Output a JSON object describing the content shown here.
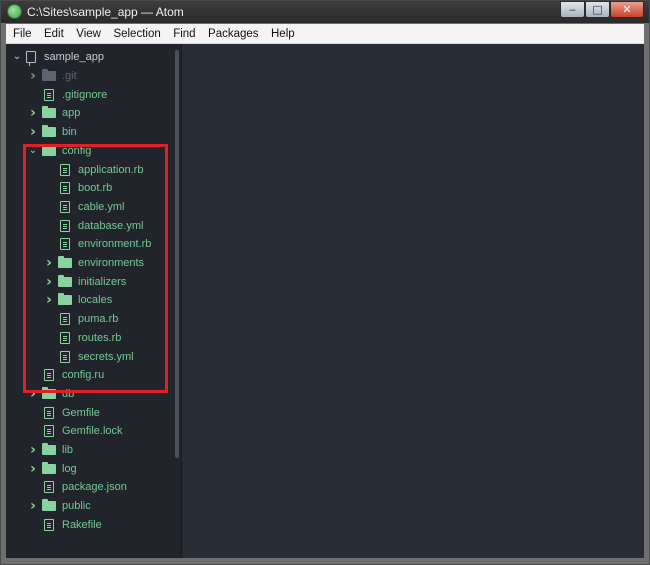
{
  "window": {
    "title": "C:\\Sites\\sample_app — Atom",
    "minimize": "‒",
    "maximize": "□",
    "close": "✕"
  },
  "menu": [
    "File",
    "Edit",
    "View",
    "Selection",
    "Find",
    "Packages",
    "Help"
  ],
  "tree": {
    "root": "sample_app",
    "items": [
      {
        "label": ".git",
        "kind": "folder",
        "expanded": false,
        "style": "dim"
      },
      {
        "label": ".gitignore",
        "kind": "file",
        "style": "green"
      },
      {
        "label": "app",
        "kind": "folder",
        "expanded": false,
        "style": "green"
      },
      {
        "label": "bin",
        "kind": "folder",
        "expanded": false,
        "style": "green"
      },
      {
        "label": "config",
        "kind": "folder",
        "expanded": true,
        "style": "green"
      },
      {
        "label": "application.rb",
        "kind": "file",
        "style": "green"
      },
      {
        "label": "boot.rb",
        "kind": "file",
        "style": "green"
      },
      {
        "label": "cable.yml",
        "kind": "file",
        "style": "green"
      },
      {
        "label": "database.yml",
        "kind": "file",
        "style": "green"
      },
      {
        "label": "environment.rb",
        "kind": "file",
        "style": "green"
      },
      {
        "label": "environments",
        "kind": "folder",
        "expanded": false,
        "style": "green"
      },
      {
        "label": "initializers",
        "kind": "folder",
        "expanded": false,
        "style": "green"
      },
      {
        "label": "locales",
        "kind": "folder",
        "expanded": false,
        "style": "green"
      },
      {
        "label": "puma.rb",
        "kind": "file",
        "style": "green"
      },
      {
        "label": "routes.rb",
        "kind": "file",
        "style": "green"
      },
      {
        "label": "secrets.yml",
        "kind": "file",
        "style": "green"
      },
      {
        "label": "config.ru",
        "kind": "file",
        "style": "green"
      },
      {
        "label": "db",
        "kind": "folder",
        "expanded": false,
        "style": "green"
      },
      {
        "label": "Gemfile",
        "kind": "file",
        "style": "green"
      },
      {
        "label": "Gemfile.lock",
        "kind": "file",
        "style": "green"
      },
      {
        "label": "lib",
        "kind": "folder",
        "expanded": false,
        "style": "green"
      },
      {
        "label": "log",
        "kind": "folder",
        "expanded": false,
        "style": "green"
      },
      {
        "label": "package.json",
        "kind": "file",
        "style": "green"
      },
      {
        "label": "public",
        "kind": "folder",
        "expanded": false,
        "style": "green"
      },
      {
        "label": "Rakefile",
        "kind": "file",
        "style": "green"
      }
    ]
  },
  "colors": {
    "tree_bg": "#21252b",
    "editor_bg": "#282c34",
    "added_green": "#73c991",
    "highlight_red": "#e01f27"
  },
  "icons": {
    "folder": "folder-icon",
    "file": "file-text-icon",
    "repo": "repo-icon",
    "chevron_right": "chevron-right-icon",
    "chevron_down": "chevron-down-icon"
  }
}
